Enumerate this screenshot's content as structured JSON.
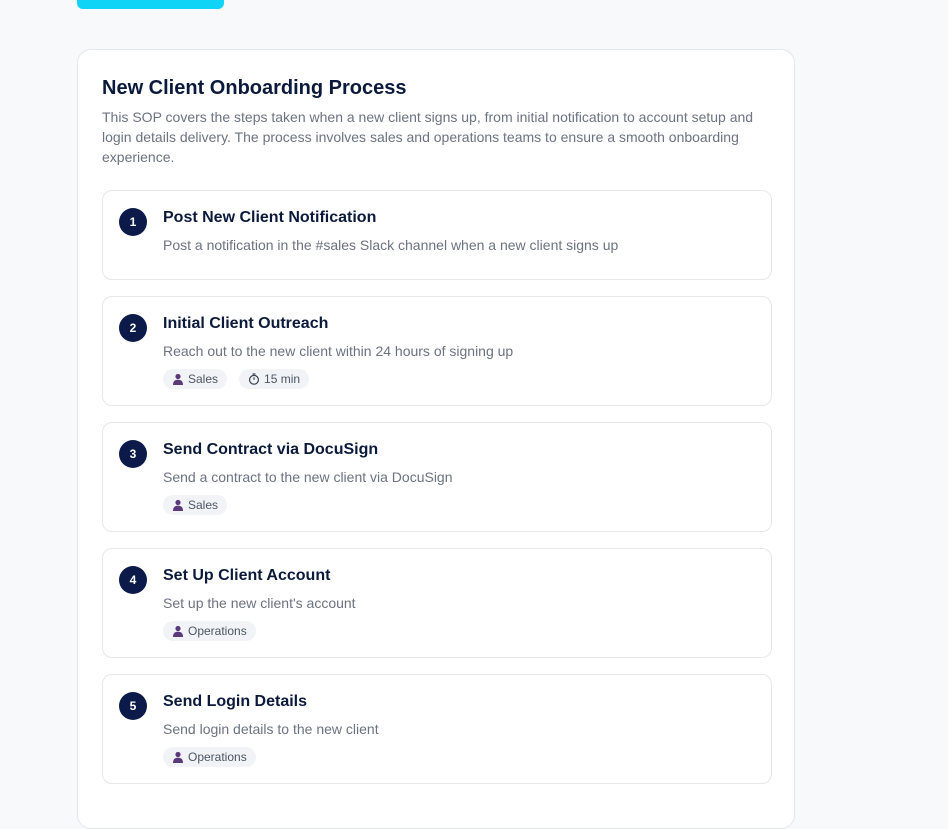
{
  "sop": {
    "title": "New Client Onboarding Process",
    "description": "This SOP covers the steps taken when a new client signs up, from initial notification to account setup and login details delivery. The process involves sales and operations teams to ensure a smooth onboarding experience."
  },
  "steps": [
    {
      "number": "1",
      "title": "Post New Client Notification",
      "description": "Post a notification in the #sales Slack channel when a new client signs up"
    },
    {
      "number": "2",
      "title": "Initial Client Outreach",
      "description": "Reach out to the new client within 24 hours of signing up",
      "role": "Sales",
      "duration": "15 min"
    },
    {
      "number": "3",
      "title": "Send Contract via DocuSign",
      "description": "Send a contract to the new client via DocuSign",
      "role": "Sales"
    },
    {
      "number": "4",
      "title": "Set Up Client Account",
      "description": "Set up the new client's account",
      "role": "Operations"
    },
    {
      "number": "5",
      "title": "Send Login Details",
      "description": "Send login details to the new client",
      "role": "Operations"
    }
  ],
  "icons": {
    "role": "user-icon",
    "duration": "timer-icon"
  },
  "colors": {
    "accent_button": "#10d4f5",
    "step_badge": "#0b1a48",
    "user_icon": "#5b3a7a"
  }
}
